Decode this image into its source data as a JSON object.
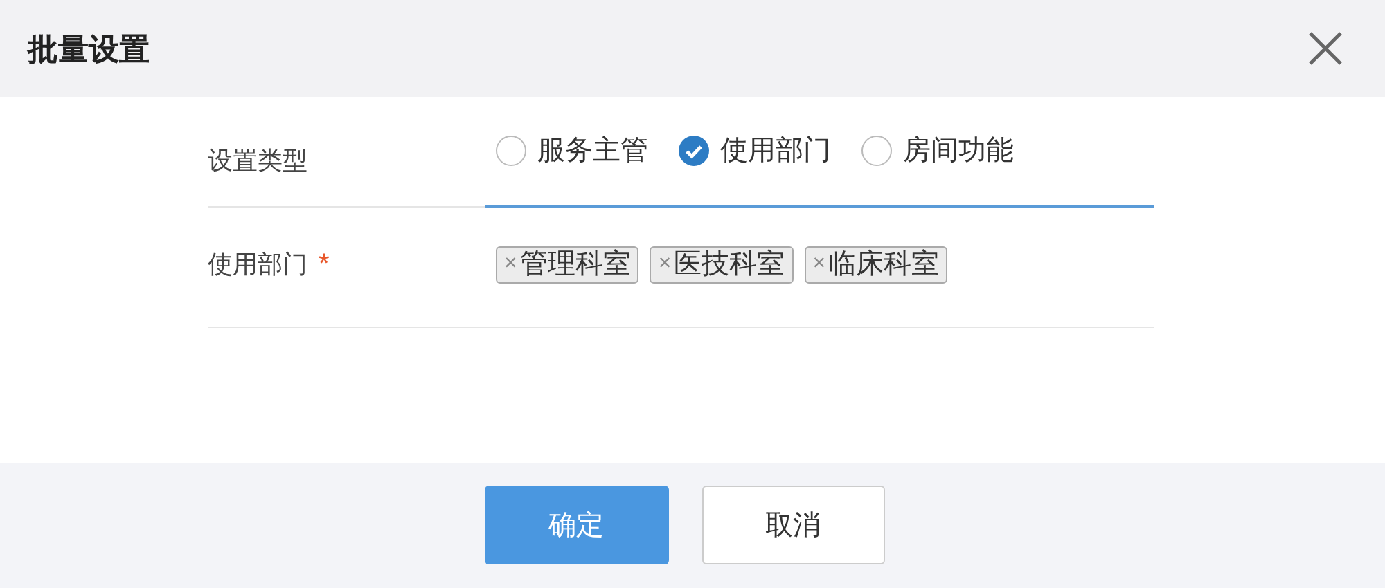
{
  "dialog": {
    "title": "批量设置"
  },
  "form": {
    "type_row": {
      "label": "设置类型",
      "options": [
        {
          "label": "服务主管",
          "selected": false
        },
        {
          "label": "使用部门",
          "selected": true
        },
        {
          "label": "房间功能",
          "selected": false
        }
      ]
    },
    "department_row": {
      "label": "使用部门",
      "required_mark": "*",
      "tags": [
        {
          "remove": "×",
          "label": "管理科室"
        },
        {
          "remove": "×",
          "label": "医技科室"
        },
        {
          "remove": "×",
          "label": "临床科室"
        }
      ]
    }
  },
  "buttons": [
    {
      "label": "确定",
      "kind": "primary"
    },
    {
      "label": "取消",
      "kind": "secondary"
    }
  ]
}
